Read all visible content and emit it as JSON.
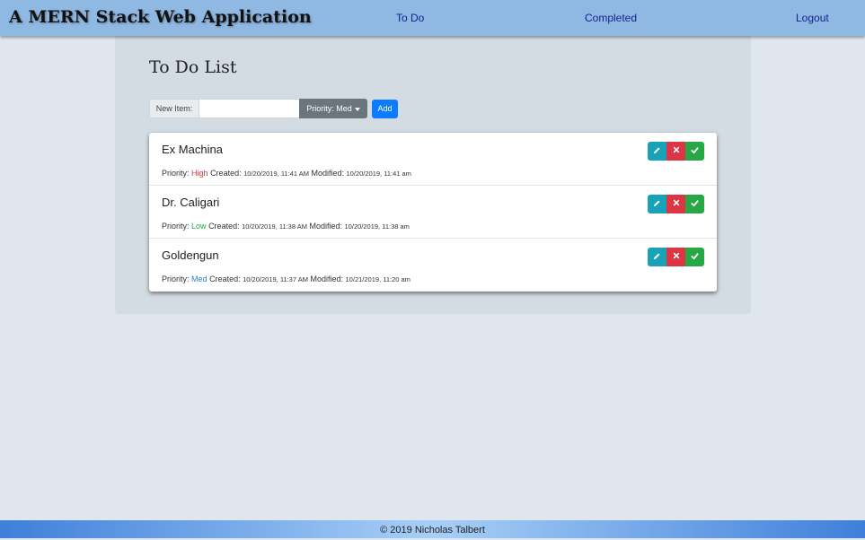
{
  "navbar": {
    "brand": "A MERN Stack Web Application",
    "links": [
      "To Do",
      "Completed",
      "Logout"
    ]
  },
  "panel": {
    "title": "To Do List",
    "new_item_label": "New Item:",
    "new_item_value": "",
    "priority_label": "Priority: Med",
    "add_label": "Add"
  },
  "items": [
    {
      "title": "Ex Machina",
      "priority_prefix": "Priority:",
      "priority": "High",
      "created_prefix": "Created:",
      "created": "10/20/2019, 11:41 AM",
      "modified_prefix": "Modified:",
      "modified": "10/20/2019, 11:41 am"
    },
    {
      "title": "Dr. Caligari",
      "priority_prefix": "Priority:",
      "priority": "Low",
      "created_prefix": "Created:",
      "created": "10/20/2019, 11:38 AM",
      "modified_prefix": "Modified:",
      "modified": "10/20/2019, 11:38 am"
    },
    {
      "title": "Goldengun",
      "priority_prefix": "Priority:",
      "priority": "Med",
      "created_prefix": "Created:",
      "created": "10/20/2019, 11:37 AM",
      "modified_prefix": "Modified:",
      "modified": "10/21/2019, 11:20 am"
    }
  ],
  "icons": {
    "edit": "pencil-icon",
    "delete": "close-icon",
    "complete": "checkmark-icon",
    "dropdown": "caret-down-icon"
  },
  "colors": {
    "navbar": "#8fb9e3",
    "edit": "#17a2b8",
    "delete": "#dc3545",
    "complete": "#28a745",
    "add": "#0d7bff",
    "priority_high": "#dc3545",
    "priority_low": "#28a745",
    "priority_med": "#2b7fd6"
  },
  "footer": {
    "text": "© 2019 Nicholas Talbert"
  }
}
